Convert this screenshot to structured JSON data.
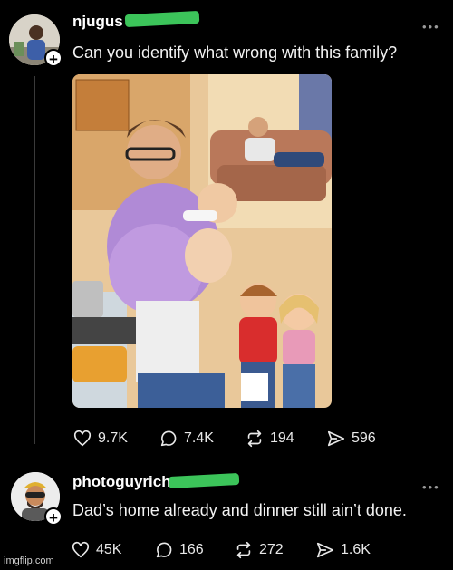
{
  "post": {
    "username": "njugus",
    "text": "Can you identify what wrong with this family?",
    "more_label": "•••",
    "actions": {
      "likes": "9.7K",
      "comments": "7.4K",
      "reposts": "194",
      "shares": "596"
    }
  },
  "reply": {
    "username": "photoguyrich",
    "text": "Dad’s home already and dinner still ain’t done.",
    "more_label": "•••",
    "actions": {
      "likes": "45K",
      "comments": "166",
      "reposts": "272",
      "shares": "1.6K"
    }
  },
  "follow_label": "+",
  "watermark": "imgflip.com",
  "colors": {
    "redaction": "#3cc45a",
    "background": "#000000"
  }
}
